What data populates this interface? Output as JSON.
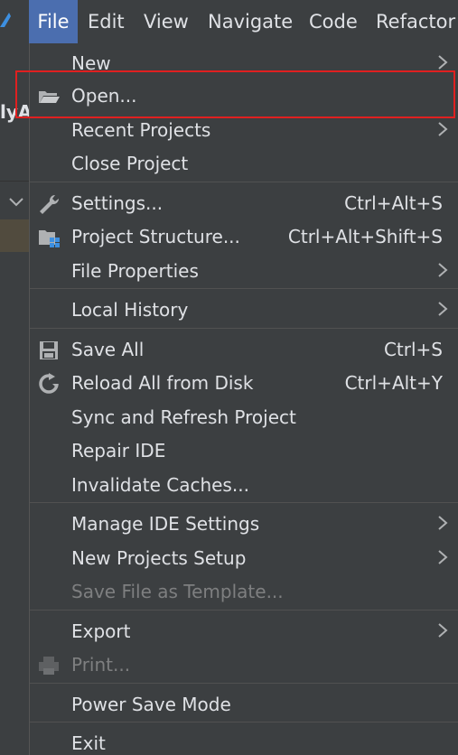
{
  "menubar": {
    "file": "File",
    "edit": "Edit",
    "view": "View",
    "navigate": "Navigate",
    "code": "Code",
    "refactor": "Refactor"
  },
  "background": {
    "project_fragment": "lyA"
  },
  "file_menu": {
    "items": [
      {
        "label": "New",
        "has_submenu": true
      },
      {
        "label": "Open...",
        "icon": "folder-open-icon"
      },
      {
        "label": "Recent Projects",
        "has_submenu": true
      },
      {
        "label": "Close Project"
      },
      {
        "label": "Settings...",
        "icon": "wrench-icon",
        "shortcut": "Ctrl+Alt+S"
      },
      {
        "label": "Project Structure...",
        "icon": "project-structure-icon",
        "shortcut": "Ctrl+Alt+Shift+S"
      },
      {
        "label": "File Properties",
        "has_submenu": true
      },
      {
        "label": "Local History",
        "has_submenu": true
      },
      {
        "label": "Save All",
        "icon": "save-icon",
        "shortcut": "Ctrl+S"
      },
      {
        "label": "Reload All from Disk",
        "icon": "reload-icon",
        "shortcut": "Ctrl+Alt+Y"
      },
      {
        "label": "Sync and Refresh Project"
      },
      {
        "label": "Repair IDE"
      },
      {
        "label": "Invalidate Caches..."
      },
      {
        "label": "Manage IDE Settings",
        "has_submenu": true
      },
      {
        "label": "New Projects Setup",
        "has_submenu": true
      },
      {
        "label": "Save File as Template...",
        "disabled": true
      },
      {
        "label": "Export",
        "has_submenu": true
      },
      {
        "label": "Print...",
        "icon": "printer-icon",
        "disabled": true
      },
      {
        "label": "Power Save Mode"
      },
      {
        "label": "Exit"
      }
    ]
  },
  "colors": {
    "menu_bg": "#3c3f41",
    "active_menu_bg": "#4b6eaf",
    "text": "#dfe1e5",
    "disabled_text": "#7e7f80",
    "highlight_box": "#e02020"
  }
}
